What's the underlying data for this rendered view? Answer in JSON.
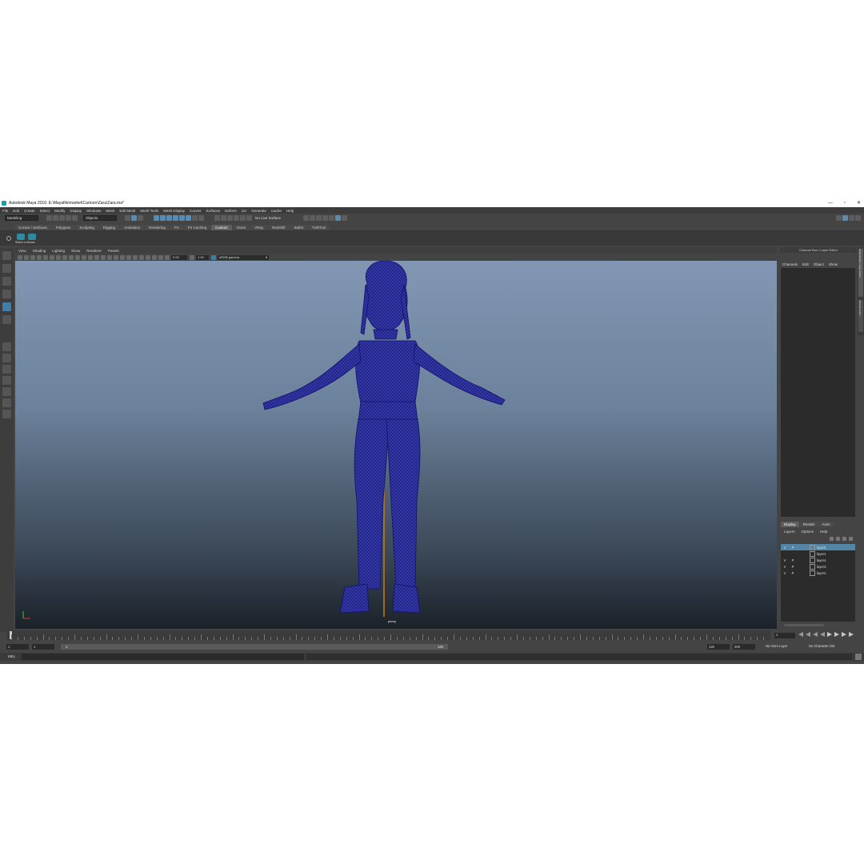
{
  "window": {
    "title": "Autodesk Maya 2016: E:\\Mayafile\\market\\Cartoon\\Zara\\Zara.ma*",
    "controls": [
      "—",
      "▫",
      "✕"
    ]
  },
  "menu": [
    "File",
    "Edit",
    "Create",
    "Select",
    "Modify",
    "Display",
    "Windows",
    "Mesh",
    "Edit Mesh",
    "Mesh Tools",
    "Mesh Display",
    "Curves",
    "Surfaces",
    "Deform",
    "UV",
    "Generate",
    "Cache",
    "Help"
  ],
  "status_line": {
    "mode": "Modeling",
    "selection_field": "Objects",
    "live_surface": "No Live Surface"
  },
  "shelf": {
    "tabs": [
      "Curves / Surfaces",
      "Polygons",
      "Sculpting",
      "Rigging",
      "Animation",
      "Rendering",
      "FX",
      "FX Caching",
      "Custom",
      "XGen",
      "VRay",
      "Redshift",
      "Bullet",
      "TURTLE"
    ],
    "active_tab": "Custom",
    "buttons": [
      {
        "label": "Select a Mouse"
      }
    ]
  },
  "viewport": {
    "menu": [
      "View",
      "Shading",
      "Lighting",
      "Show",
      "Renderer",
      "Panels"
    ],
    "exposure": "0.00",
    "gamma": "1.00",
    "color_space": "sRGB gamma",
    "camera": "persp"
  },
  "channel_box": {
    "title": "Channel Box / Layer Editor",
    "menu": [
      "Channels",
      "Edit",
      "Object",
      "Show"
    ],
    "side_tabs": [
      "Channel Box / Layer Editor",
      "Attribute Editor"
    ]
  },
  "layer_editor": {
    "tabs": [
      "Display",
      "Render",
      "Anim"
    ],
    "active_tab": "Display",
    "menu": [
      "Layers",
      "Options",
      "Help"
    ],
    "layers": [
      {
        "v": "V",
        "p": "P",
        "name": "layer5",
        "selected": true
      },
      {
        "v": "",
        "p": "",
        "name": "layer1",
        "selected": false
      },
      {
        "v": "V",
        "p": "P",
        "name": "layer4",
        "selected": false
      },
      {
        "v": "V",
        "p": "P",
        "name": "layer3",
        "selected": false
      },
      {
        "v": "V",
        "p": "P",
        "name": "layer2",
        "selected": false
      }
    ]
  },
  "time": {
    "current_frame": "1",
    "range_start": "1",
    "playback_start": "1",
    "playback_bar_start": "1",
    "playback_bar_end": "120",
    "playback_end": "120",
    "range_end": "200",
    "anim_layer": "No Anim Layer",
    "character_set": "No Character Set"
  },
  "command_line": {
    "label": "MEL"
  },
  "colors": {
    "wire": "#1c1f8c",
    "accent": "#5285a6",
    "bg": "#444444"
  }
}
